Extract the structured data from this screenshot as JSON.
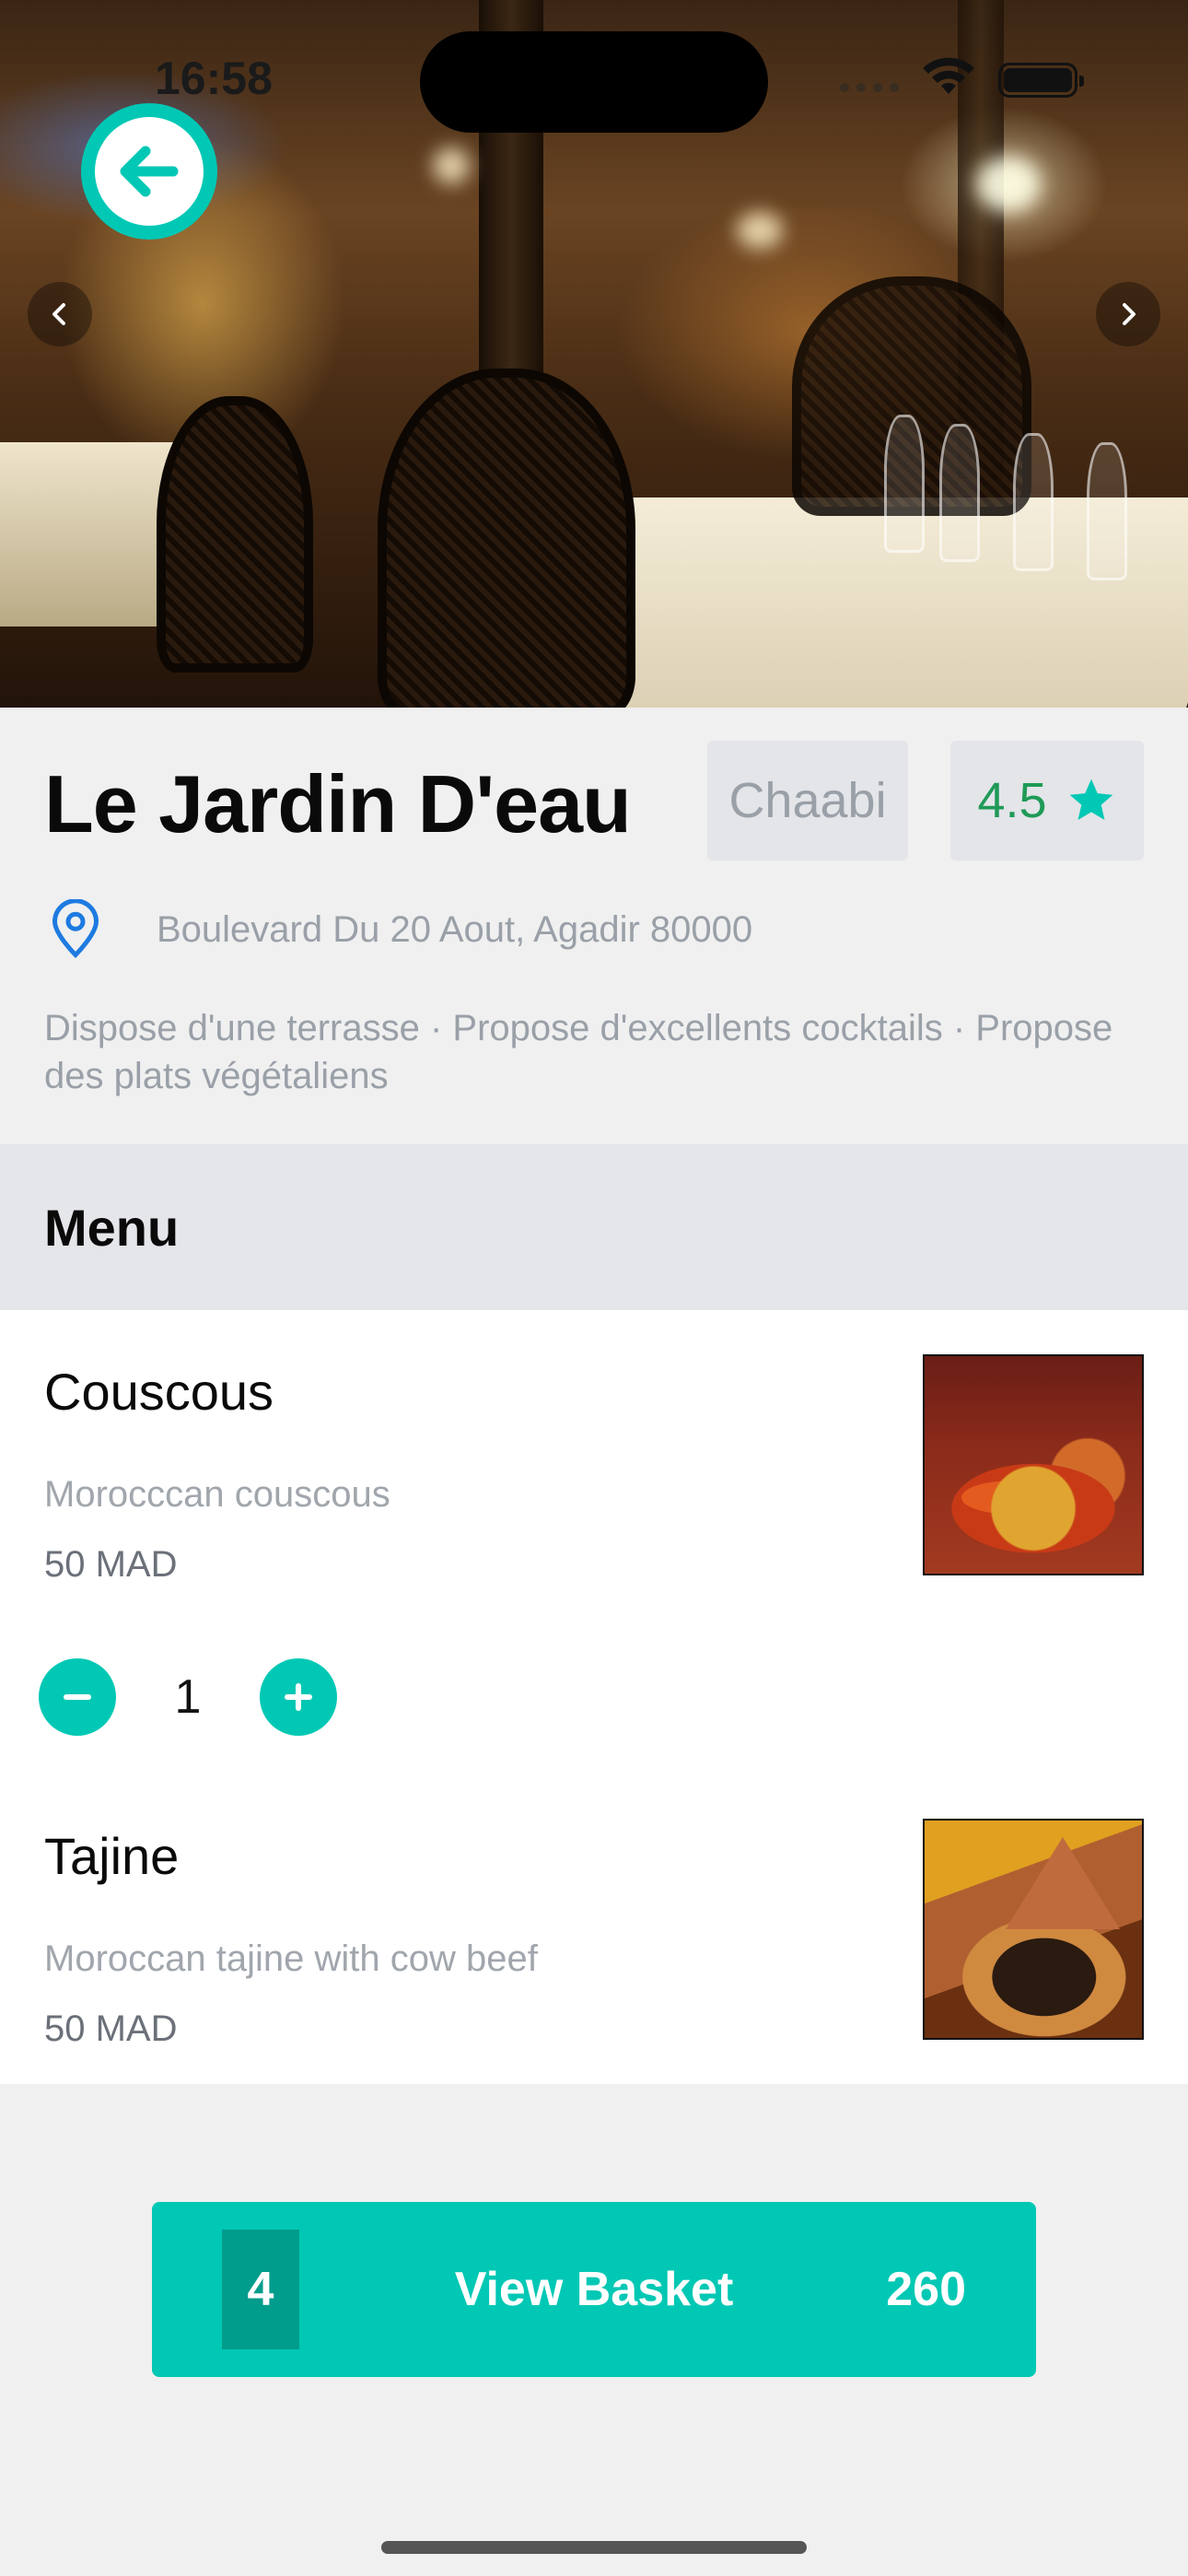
{
  "status_bar": {
    "time": "16:58"
  },
  "hero": {
    "image": "restaurant-interior-photo"
  },
  "restaurant": {
    "name": "Le Jardin D'eau",
    "cuisine": "Chaabi",
    "rating": "4.5",
    "address": "Boulevard Du 20 Aout, Agadir 80000",
    "tags": "Dispose d'une terrasse · Propose d'excellents cocktails · Propose des plats végétaliens"
  },
  "menu": {
    "title": "Menu",
    "items": [
      {
        "name": "Couscous",
        "description": "Morocccan couscous",
        "price": "50 MAD",
        "quantity": "1",
        "image": "couscous-dish-photo"
      },
      {
        "name": "Tajine",
        "description": "Moroccan tajine with cow beef",
        "price": "50 MAD",
        "image": "tajine-dish-photo"
      }
    ]
  },
  "basket": {
    "count": "4",
    "label": "View Basket",
    "total": "260"
  },
  "colors": {
    "accent": "#00c8b4",
    "rating_green": "#1f9a57",
    "location_blue": "#1e7be0"
  },
  "icons": [
    "back-arrow-icon",
    "chevron-left-icon",
    "chevron-right-icon",
    "star-icon",
    "location-pin-icon",
    "minus-icon",
    "plus-icon",
    "wifi-icon",
    "battery-icon"
  ]
}
